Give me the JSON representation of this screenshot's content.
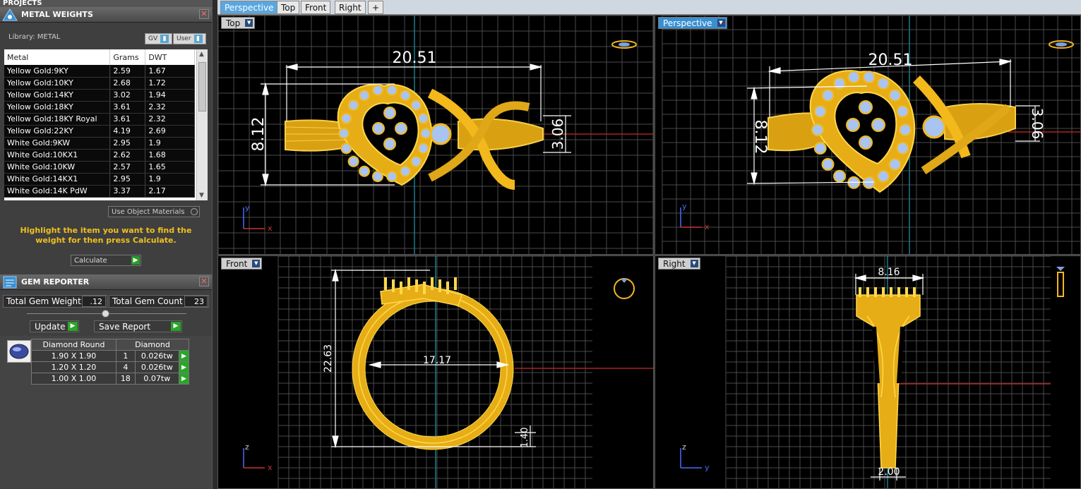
{
  "projects": {
    "title": "PROJECTS"
  },
  "metal_weights": {
    "title": "METAL WEIGHTS",
    "library_label": "Library: METAL",
    "gv_label": "GV",
    "user_label": "User",
    "columns": [
      "Metal",
      "Grams",
      "DWT"
    ],
    "rows": [
      [
        "Yellow Gold:9KY",
        "2.59",
        "1.67"
      ],
      [
        "Yellow Gold:10KY",
        "2.68",
        "1.72"
      ],
      [
        "Yellow Gold:14KY",
        "3.02",
        "1.94"
      ],
      [
        "Yellow Gold:18KY",
        "3.61",
        "2.32"
      ],
      [
        "Yellow Gold:18KY Royal",
        "3.61",
        "2.32"
      ],
      [
        "Yellow Gold:22KY",
        "4.19",
        "2.69"
      ],
      [
        "White Gold:9KW",
        "2.95",
        "1.9"
      ],
      [
        "White Gold:10KX1",
        "2.62",
        "1.68"
      ],
      [
        "White Gold:10KW",
        "2.57",
        "1.65"
      ],
      [
        "White Gold:14KX1",
        "2.95",
        "1.9"
      ],
      [
        "White Gold:14K PdW",
        "3.37",
        "2.17"
      ]
    ],
    "use_object_materials": "Use Object Materials",
    "hint": "Highlight the item you want to find the weight for then press Calculate.",
    "calculate": "Calculate"
  },
  "gem_reporter": {
    "title": "GEM REPORTER",
    "total_weight_label": "Total Gem Weight",
    "total_weight_value": ".12",
    "total_count_label": "Total Gem Count",
    "total_count_value": "23",
    "update": "Update",
    "save_report": "Save Report",
    "table_header": [
      "Diamond Round",
      "Diamond"
    ],
    "rows": [
      [
        "1.90 X 1.90",
        "1",
        "0.026tw"
      ],
      [
        "1.20 X 1.20",
        "4",
        "0.026tw"
      ],
      [
        "1.00 X 1.00",
        "18",
        "0.07tw"
      ]
    ]
  },
  "tabs": [
    "Perspective",
    "Top",
    "Front",
    "Right",
    "+"
  ],
  "viewports": {
    "top": {
      "label": "Top",
      "dim_width": "20.51",
      "dim_height": "8.12",
      "dim_small": "3.06",
      "axis_y": "y",
      "axis_x": "x"
    },
    "perspective": {
      "label": "Perspective",
      "dim_width": "20.51",
      "dim_height": "8.12",
      "dim_small": "3.06",
      "axis_y": "y",
      "axis_x": "x"
    },
    "front": {
      "label": "Front",
      "dim_height": "22.63",
      "dim_inner": "17.17",
      "dim_small": "1.40",
      "axis_z": "z",
      "axis_x": "x"
    },
    "right": {
      "label": "Right",
      "dim_top": "8.16",
      "dim_bottom": "2.00",
      "axis_z": "z",
      "axis_y": "y"
    }
  },
  "colors": {
    "gold": "#f2b81c",
    "gem": "#a9c4f0",
    "grid": "#4a4a4a",
    "accent": "#3a8fd0"
  }
}
